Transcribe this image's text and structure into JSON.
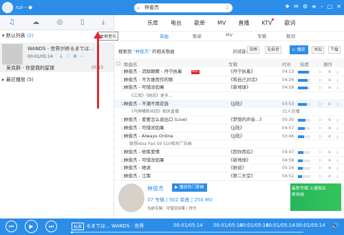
{
  "user": {
    "name": "rui···",
    "badge_icon": "diamond-icon"
  },
  "search": {
    "value": "林俊杰"
  },
  "left_tabs": {
    "download_tooltip": "本地音乐"
  },
  "playlist": {
    "title": "默认列表",
    "count": "(2)"
  },
  "now_playing": {
    "title": "WANDS - 世界が終るまでは...",
    "time": "00:01/05:14",
    "icons": "↓♡⊕⋯",
    "second_title": "吴克群 - 你是我的星球",
    "second_dur": "05:15"
  },
  "recent": {
    "title": "最近播放 (5)"
  },
  "nav": {
    "items": [
      "乐库",
      "电台",
      "歌单",
      "MV",
      "直播",
      "KTV",
      "歌词"
    ]
  },
  "subtabs": [
    "单曲",
    "歌单",
    "MV",
    "专辑",
    "歌词"
  ],
  "filter": {
    "prefix": "搜索到",
    "keyword": "\"林俊杰\"",
    "suffix": "的相关歌曲",
    "quality_label": "对试音:",
    "quality_opts": [
      "流畅",
      "无损音"
    ],
    "play_label": "▷ 播放",
    "add_label": "添加",
    "download_label": "下载"
  },
  "table_head": {
    "song": "歌曲名",
    "album": "专辑",
    "duration": "时长",
    "heat": "热度",
    "action": "操作"
  },
  "rows": [
    {
      "name": "林俊杰 - 消除眼睛 - 丹宁执着",
      "hot": "HOT",
      "album": "《丹宁执着》",
      "dur": "04:13",
      "heat": 0.9,
      "type": "main"
    },
    {
      "name": "林俊杰 - 不为谁而作的歌",
      "album": "《和自己对话》",
      "dur": "04:26",
      "heat": 0.8,
      "type": "main"
    },
    {
      "name": "林俊杰 - 可惜没如果",
      "album": "《新地球》",
      "dur": "04:58",
      "heat": 0.75,
      "type": "main"
    },
    {
      "name": "《江南》《她说》更多...",
      "album": "",
      "dur": "",
      "heat": 0,
      "type": "sub"
    },
    {
      "name": "林俊杰 - 不潮不用花钱",
      "album": "《JJ陆》",
      "dur": "03:53",
      "heat": 0.7,
      "type": "main",
      "checked": true
    },
    {
      "name": "《乌鸦嘴粉丝团》相关直播",
      "album": "",
      "dur": "31人在播",
      "heat": 0,
      "type": "sub"
    },
    {
      "name": "林俊杰 - 爱要怎么说出口 (Live)",
      "album": "《梦想的声音...》",
      "dur": "05:30",
      "heat": 0.6,
      "type": "main"
    },
    {
      "name": "林俊杰 - 可惜没如果",
      "album": "《JJ陆》",
      "dur": "04:57",
      "heat": 0.55,
      "type": "main"
    },
    {
      "name": "林俊杰 - Always Online",
      "album": "《JJ陆》",
      "dur": "03:46",
      "heat": 0.5,
      "type": "main"
    },
    {
      "name": "联想Idea Pad S9 S10相关广告曲",
      "album": "",
      "dur": "",
      "heat": 0,
      "type": "sub"
    },
    {
      "name": "林俊杰 - 修炼爱情",
      "album": "《因你而在》",
      "dur": "04:47",
      "heat": 0.45,
      "type": "main"
    },
    {
      "name": "林俊杰 - 可惜没如果",
      "album": "《新地球》",
      "dur": "04:58",
      "heat": 0.4,
      "type": "main"
    },
    {
      "name": "林俊杰 - 她说",
      "album": "《她说》",
      "dur": "05:16",
      "heat": 0.38,
      "type": "main"
    },
    {
      "name": "林俊杰 - 江南",
      "album": "《第二天堂》",
      "dur": "04:52",
      "heat": 0.35,
      "type": "main"
    }
  ],
  "artist": {
    "name": "林俊杰",
    "play_label": "▶ 播放热门歌曲",
    "stats": "37 专辑 | 502 单曲 | 250 MV",
    "meta": "当前专辑：可惜没如果 | 时代",
    "promo_title": "最新专辑 火速购买",
    "promo_sub": "新地球"
  },
  "player": {
    "tag": "标准",
    "title": "るまでは... WANDS - 世界",
    "time_current": "00:01/05:14",
    "time_labels": [
      "00:01/05:14",
      "00:01/05:14",
      "00:01/05:14",
      "00:01/05:14",
      "00:01/05:14"
    ],
    "progress": 0.01
  }
}
